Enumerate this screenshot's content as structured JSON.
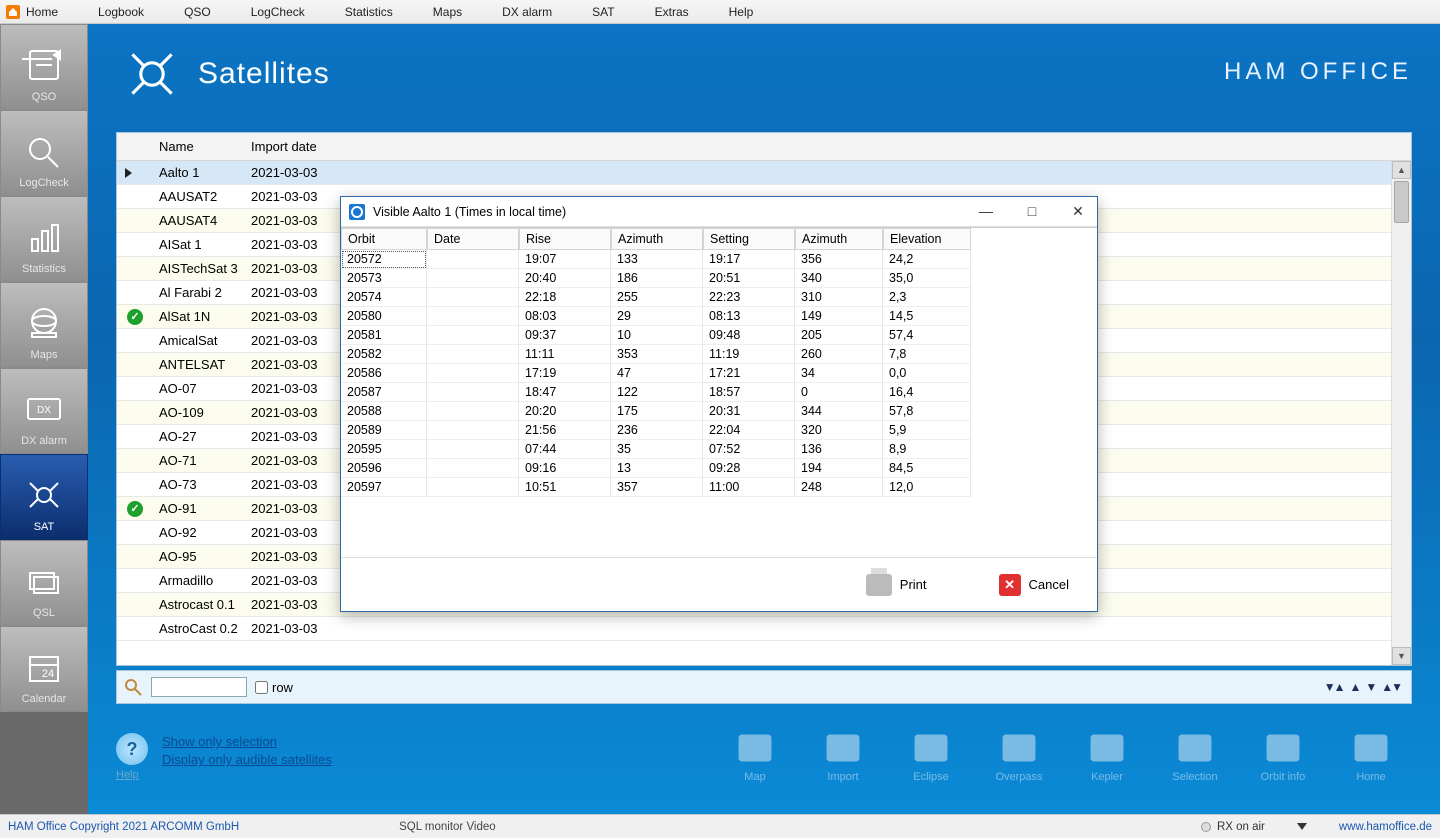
{
  "menu": {
    "items": [
      "Home",
      "Logbook",
      "QSO",
      "LogCheck",
      "Statistics",
      "Maps",
      "DX alarm",
      "SAT",
      "Extras",
      "Help"
    ]
  },
  "left_toolbar": [
    {
      "id": "qso",
      "label": "QSO"
    },
    {
      "id": "logcheck",
      "label": "LogCheck"
    },
    {
      "id": "statistics",
      "label": "Statistics"
    },
    {
      "id": "maps",
      "label": "Maps"
    },
    {
      "id": "dxalarm",
      "label": "DX alarm"
    },
    {
      "id": "sat",
      "label": "SAT",
      "active": true
    },
    {
      "id": "qsl",
      "label": "QSL"
    },
    {
      "id": "calendar",
      "label": "Calendar"
    }
  ],
  "header": {
    "title": "Satellites",
    "brand": "HAM OFFICE"
  },
  "sat_table": {
    "columns": [
      "Name",
      "Import date"
    ],
    "rows": [
      {
        "name": "Aalto 1",
        "date": "2021-03-03",
        "selected": true,
        "pointer": true
      },
      {
        "name": "AAUSAT2",
        "date": "2021-03-03"
      },
      {
        "name": "AAUSAT4",
        "date": "2021-03-03"
      },
      {
        "name": "AISat 1",
        "date": "2021-03-03"
      },
      {
        "name": "AISTechSat 3",
        "date": "2021-03-03"
      },
      {
        "name": "Al Farabi 2",
        "date": "2021-03-03"
      },
      {
        "name": "AlSat 1N",
        "date": "2021-03-03",
        "check": true
      },
      {
        "name": "AmicalSat",
        "date": "2021-03-03"
      },
      {
        "name": "ANTELSAT",
        "date": "2021-03-03"
      },
      {
        "name": "AO-07",
        "date": "2021-03-03"
      },
      {
        "name": "AO-109",
        "date": "2021-03-03"
      },
      {
        "name": "AO-27",
        "date": "2021-03-03"
      },
      {
        "name": "AO-71",
        "date": "2021-03-03"
      },
      {
        "name": "AO-73",
        "date": "2021-03-03"
      },
      {
        "name": "AO-91",
        "date": "2021-03-03",
        "check": true
      },
      {
        "name": "AO-92",
        "date": "2021-03-03"
      },
      {
        "name": "AO-95",
        "date": "2021-03-03"
      },
      {
        "name": "Armadillo",
        "date": "2021-03-03"
      },
      {
        "name": "Astrocast 0.1",
        "date": "2021-03-03"
      },
      {
        "name": "AstroCast 0.2",
        "date": "2021-03-03"
      }
    ]
  },
  "searchbar": {
    "row_label": "row"
  },
  "help_links": {
    "help_label": "Help",
    "link1": "Show only selection",
    "link2": "Display only audible satellites"
  },
  "bottom_actions": [
    "Map",
    "Import",
    "Eclipse",
    "Overpass",
    "Kepler",
    "Selection",
    "Orbit info",
    "Home"
  ],
  "popup": {
    "title": "Visible Aalto 1  (Times in local time)",
    "columns": [
      "Orbit",
      "Date",
      "Rise",
      "Azimuth",
      "Setting",
      "Azimuth",
      "Elevation"
    ],
    "rows": [
      {
        "orbit": "20572",
        "date": "",
        "rise": "19:07",
        "az1": "133",
        "setting": "19:17",
        "az2": "356",
        "elev": "24,2"
      },
      {
        "orbit": "20573",
        "date": "",
        "rise": "20:40",
        "az1": "186",
        "setting": "20:51",
        "az2": "340",
        "elev": "35,0"
      },
      {
        "orbit": "20574",
        "date": "",
        "rise": "22:18",
        "az1": "255",
        "setting": "22:23",
        "az2": "310",
        "elev": "2,3"
      },
      {
        "orbit": "20580",
        "date": "",
        "rise": "08:03",
        "az1": "29",
        "setting": "08:13",
        "az2": "149",
        "elev": "14,5"
      },
      {
        "orbit": "20581",
        "date": "",
        "rise": "09:37",
        "az1": "10",
        "setting": "09:48",
        "az2": "205",
        "elev": "57,4"
      },
      {
        "orbit": "20582",
        "date": "",
        "rise": "11:11",
        "az1": "353",
        "setting": "11:19",
        "az2": "260",
        "elev": "7,8"
      },
      {
        "orbit": "20586",
        "date": "",
        "rise": "17:19",
        "az1": "47",
        "setting": "17:21",
        "az2": "34",
        "elev": "0,0"
      },
      {
        "orbit": "20587",
        "date": "",
        "rise": "18:47",
        "az1": "122",
        "setting": "18:57",
        "az2": "0",
        "elev": "16,4"
      },
      {
        "orbit": "20588",
        "date": "",
        "rise": "20:20",
        "az1": "175",
        "setting": "20:31",
        "az2": "344",
        "elev": "57,8"
      },
      {
        "orbit": "20589",
        "date": "",
        "rise": "21:56",
        "az1": "236",
        "setting": "22:04",
        "az2": "320",
        "elev": "5,9"
      },
      {
        "orbit": "20595",
        "date": "",
        "rise": "07:44",
        "az1": "35",
        "setting": "07:52",
        "az2": "136",
        "elev": "8,9"
      },
      {
        "orbit": "20596",
        "date": "",
        "rise": "09:16",
        "az1": "13",
        "setting": "09:28",
        "az2": "194",
        "elev": "84,5"
      },
      {
        "orbit": "20597",
        "date": "",
        "rise": "10:51",
        "az1": "357",
        "setting": "11:00",
        "az2": "248",
        "elev": "12,0"
      }
    ],
    "print_label": "Print",
    "cancel_label": "Cancel"
  },
  "statusbar": {
    "copyright": "HAM Office Copyright 2021 ARCOMM GmbH",
    "mid": "SQL monitor   Video",
    "rx": "RX on air",
    "url": "www.hamoffice.de"
  }
}
